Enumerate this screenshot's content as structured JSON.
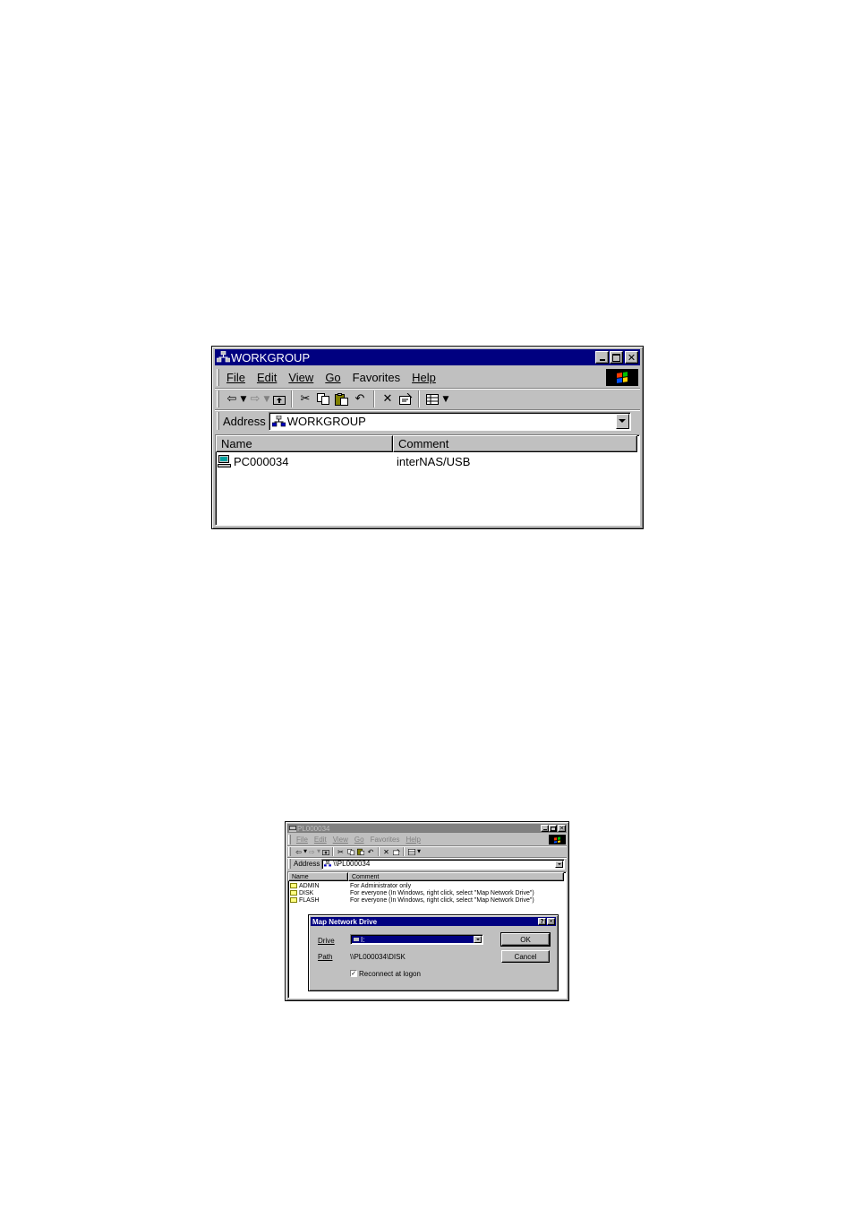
{
  "window1": {
    "title": "WORKGROUP",
    "menu": {
      "file": "File",
      "edit": "Edit",
      "view": "View",
      "go": "Go",
      "favorites": "Favorites",
      "help": "Help"
    },
    "address_label": "Address",
    "address_value": "WORKGROUP",
    "columns": {
      "name": "Name",
      "comment": "Comment"
    },
    "rows": [
      {
        "name": "PC000034",
        "comment": "interNAS/USB"
      }
    ]
  },
  "window2": {
    "title": "PL000034",
    "menu": {
      "file": "File",
      "edit": "Edit",
      "view": "View",
      "go": "Go",
      "favorites": "Favorites",
      "help": "Help"
    },
    "address_label": "Address",
    "address_value": "\\\\PL000034",
    "columns": {
      "name": "Name",
      "comment": "Comment"
    },
    "rows": [
      {
        "name": "ADMIN",
        "comment": "For Administrator only"
      },
      {
        "name": "DISK",
        "comment": "For everyone (In Windows, right click, select \"Map Network Drive\")"
      },
      {
        "name": "FLASH",
        "comment": "For everyone (In Windows, right click, select \"Map Network Drive\")"
      }
    ],
    "dialog": {
      "title": "Map Network Drive",
      "drive_label": "Drive",
      "drive_value": "I:",
      "path_label": "Path",
      "path_value": "\\\\PL000034\\DISK",
      "reconnect_label": "Reconnect at logon",
      "reconnect_checked": "✓",
      "ok_label": "OK",
      "cancel_label": "Cancel"
    }
  }
}
